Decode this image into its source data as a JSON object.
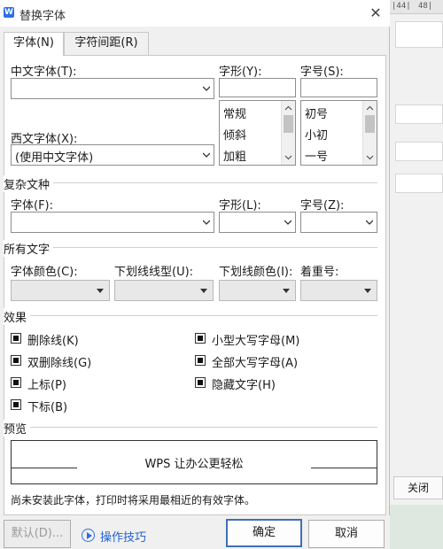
{
  "window": {
    "title": "替换字体",
    "icon": "wps-writer-icon",
    "close": "✕"
  },
  "tabs": [
    {
      "label": "字体(N)",
      "active": true
    },
    {
      "label": "字符间距(R)",
      "active": false
    }
  ],
  "chinese_font": {
    "label": "中文字体(T):",
    "value": ""
  },
  "western_font": {
    "label": "西文字体(X):",
    "value": "(使用中文字体)"
  },
  "style": {
    "label": "字形(Y):",
    "value": "",
    "options": [
      "常规",
      "倾斜",
      "加粗"
    ]
  },
  "size": {
    "label": "字号(S):",
    "value": "",
    "options": [
      "初号",
      "小初",
      "一号"
    ]
  },
  "complex": {
    "section": "复杂文种",
    "font_label": "字体(F):",
    "style_label": "字形(L):",
    "size_label": "字号(Z):"
  },
  "all_text": {
    "section": "所有文字",
    "color_label": "字体颜色(C):",
    "underline_type_label": "下划线线型(U):",
    "underline_color_label": "下划线颜色(I):",
    "emphasis_label": "着重号:"
  },
  "effects": {
    "section": "效果",
    "items": [
      {
        "label": "删除线(K)"
      },
      {
        "label": "双删除线(G)"
      },
      {
        "label": "上标(P)"
      },
      {
        "label": "下标(B)"
      },
      {
        "label": "小型大写字母(M)"
      },
      {
        "label": "全部大写字母(A)"
      },
      {
        "label": "隐藏文字(H)"
      }
    ]
  },
  "preview": {
    "section": "预览",
    "sample": "WPS 让办公更轻松"
  },
  "notice": "尚未安装此字体，打印时将采用最相近的有效字体。",
  "footer": {
    "default_button": "默认(D)...",
    "tips": "操作技巧",
    "ok": "确定",
    "cancel": "取消"
  },
  "background_app": {
    "ruler_marks": [
      "|44|",
      "48|"
    ],
    "close_button": "关闭"
  },
  "colors": {
    "accent": "#2f6fe4",
    "link": "#1f5fd6",
    "primary_border": "#3f6fb6"
  }
}
